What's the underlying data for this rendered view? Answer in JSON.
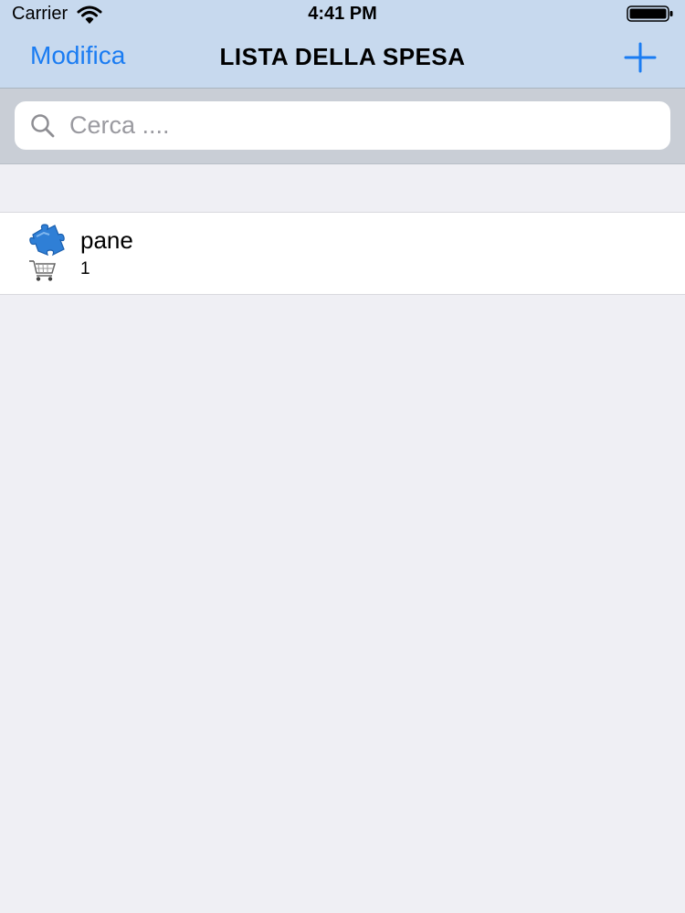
{
  "status_bar": {
    "carrier": "Carrier",
    "time": "4:41 PM",
    "icons": [
      "wifi-icon",
      "battery-icon"
    ]
  },
  "nav": {
    "edit_label": "Modifica",
    "title": "LISTA DELLA SPESA",
    "add_icon": "plus-icon"
  },
  "search": {
    "placeholder": "Cerca ....",
    "icon": "search-icon"
  },
  "items": [
    {
      "name": "pane",
      "quantity": "1",
      "icon": "puzzle-icon",
      "secondary_icon": "cart-icon"
    }
  ],
  "colors": {
    "accent": "#1a7cf2",
    "bar_background": "#c7d9ee",
    "search_background": "#c9ced6",
    "page_background": "#efeff4"
  }
}
